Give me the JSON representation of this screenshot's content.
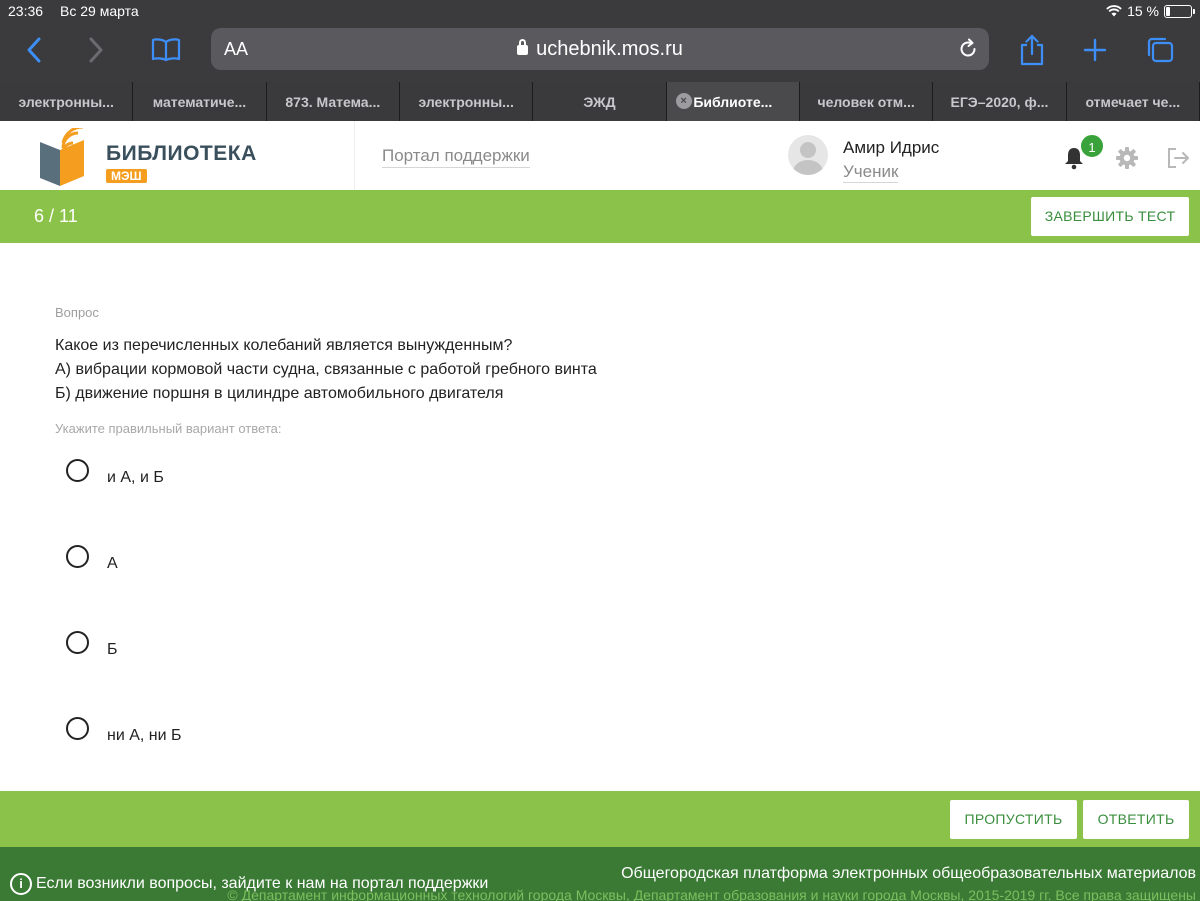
{
  "status_bar": {
    "time": "23:36",
    "date": "Вс 29 марта",
    "battery": "15 %"
  },
  "browser": {
    "text_size_label": "AA",
    "url": "uchebnik.mos.ru",
    "tabs": [
      {
        "label": "электронны...",
        "active": false
      },
      {
        "label": "математиче...",
        "active": false
      },
      {
        "label": "873. Матема...",
        "active": false
      },
      {
        "label": "электронны...",
        "active": false
      },
      {
        "label": "ЭЖД",
        "active": false
      },
      {
        "label": "Библиоте...",
        "active": true
      },
      {
        "label": "человек отм...",
        "active": false
      },
      {
        "label": "ЕГЭ–2020, ф...",
        "active": false
      },
      {
        "label": "отмечает че...",
        "active": false
      }
    ]
  },
  "header": {
    "logo_title": "БИБЛИОТЕКА",
    "logo_badge": "МЭШ",
    "support_link": "Портал поддержки",
    "user_name": "Амир Идрис",
    "user_role": "Ученик",
    "notification_count": "1"
  },
  "test": {
    "progress": "6 / 11",
    "finish_label": "ЗАВЕРШИТЬ ТЕСТ",
    "question_label": "Вопрос",
    "question_lines": [
      "Какое из перечисленных колебаний является вынужденным?",
      "А) вибрации кормовой части судна, связанные с работой гребного винта",
      "Б) движение поршня в цилиндре автомобильного двигателя"
    ],
    "hint": "Укажите правильный вариант ответа:",
    "options": [
      "и А, и Б",
      "А",
      "Б",
      "ни А, ни Б"
    ],
    "skip_label": "ПРОПУСТИТЬ",
    "answer_label": "ОТВЕТИТЬ"
  },
  "footer": {
    "help_text": "Если возникли вопросы, зайдите к нам на портал поддержки",
    "platform_text": "Общегородская платформа электронных общеобразовательных материалов",
    "copyright": "© Департамент информационных технологий города Москвы, Департамент образования и науки города Москвы, 2015-2019 гг. Все права защищены"
  },
  "colors": {
    "accent_green": "#8bc34a",
    "footer_green": "#3a7a35",
    "logo_orange": "#f49d1f",
    "safari_blue": "#3e8ef7"
  }
}
